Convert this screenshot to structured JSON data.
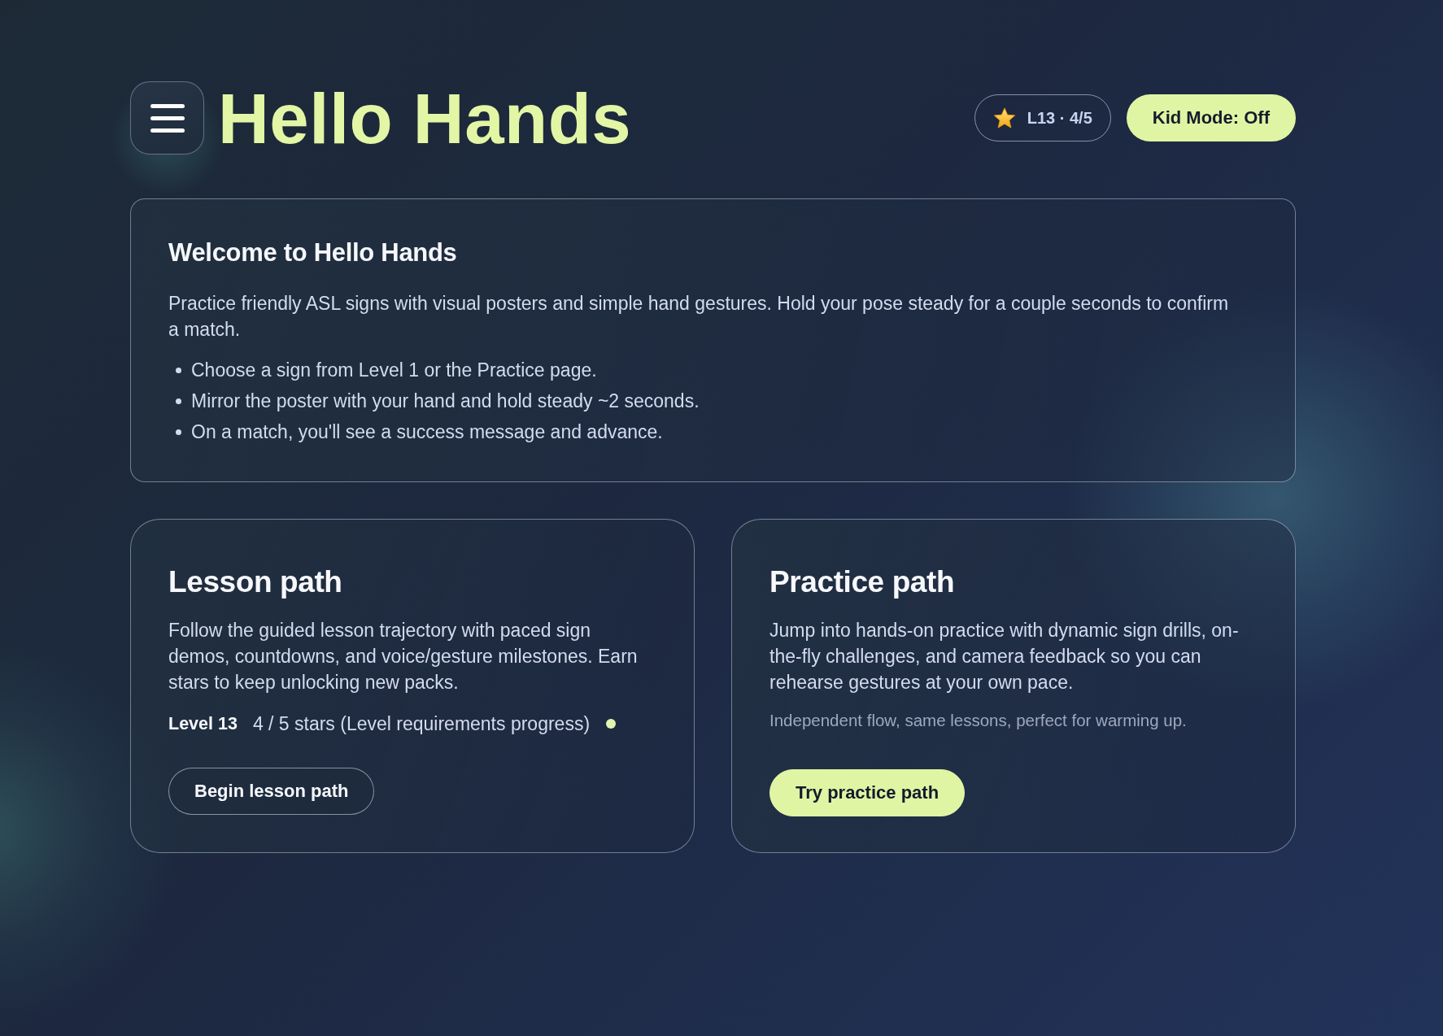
{
  "header": {
    "title": "Hello Hands",
    "progress_badge": "L13 · 4/5",
    "kid_mode_button": "Kid Mode: Off"
  },
  "welcome": {
    "title": "Welcome to Hello Hands",
    "intro": "Practice friendly ASL signs with visual posters and simple hand gestures. Hold your pose steady for a couple seconds to confirm a match.",
    "steps": [
      "Choose a sign from Level 1 or the Practice page.",
      "Mirror the poster with your hand and hold steady ~2 seconds.",
      "On a match, you'll see a success message and advance."
    ]
  },
  "paths": [
    {
      "kind": "lesson",
      "title": "Lesson path",
      "description": "Follow the guided lesson trajectory with paced sign demos, countdowns, and voice/gesture milestones. Earn stars to keep unlocking new packs.",
      "level_label": "Level 13",
      "progress_text": "4 / 5 stars (Level requirements progress)",
      "button": "Begin lesson path"
    },
    {
      "kind": "practice",
      "title": "Practice path",
      "description": "Jump into hands-on practice with dynamic sign drills, on-the-fly challenges, and camera feedback so you can rehearse gestures at your own pace.",
      "note": "Independent flow, same lessons, perfect for warming up.",
      "button": "Try practice path"
    }
  ]
}
